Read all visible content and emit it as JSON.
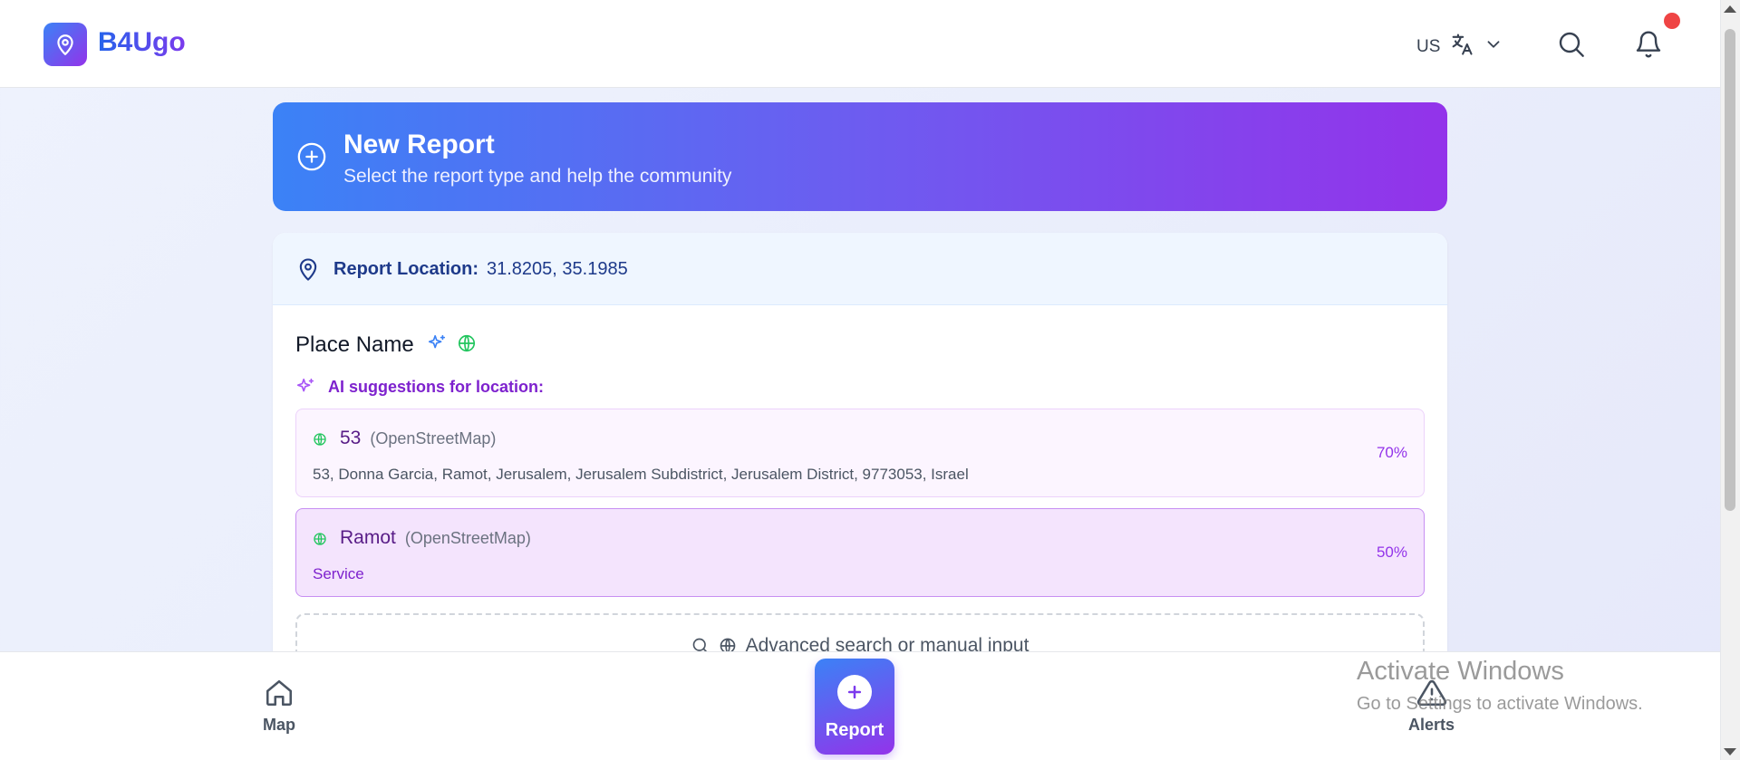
{
  "header": {
    "app_name": "B4Ugo",
    "language_code": "US"
  },
  "banner": {
    "title": "New Report",
    "subtitle": "Select the report type and help the community"
  },
  "location": {
    "label": "Report Location:",
    "value": "31.8205, 35.1985"
  },
  "place": {
    "title": "Place Name",
    "ai_label": "AI suggestions for location:",
    "suggestions": [
      {
        "name": "53",
        "source": "(OpenStreetMap)",
        "description": "53, Donna Garcia, Ramot, Jerusalem, Jerusalem Subdistrict, Jerusalem District, 9773053, Israel",
        "confidence": "70%"
      },
      {
        "name": "Ramot",
        "source": "(OpenStreetMap)",
        "description": "Service",
        "confidence": "50%"
      }
    ],
    "advanced_search": "Advanced search or manual input"
  },
  "bottom_nav": {
    "map": "Map",
    "report": "Report",
    "alerts": "Alerts"
  },
  "watermark": {
    "title": "Activate Windows",
    "subtitle": "Go to Settings to activate Windows."
  },
  "colors": {
    "brand_blue": "#3b82f6",
    "brand_purple": "#9333ea",
    "notification": "#ef4444"
  },
  "icons": [
    "map-pin-icon",
    "translate-icon",
    "chevron-down-icon",
    "search-icon",
    "bell-icon",
    "plus-circle-icon",
    "sparkles-icon",
    "globe-icon",
    "home-icon",
    "alert-triangle-icon",
    "plus-icon"
  ]
}
